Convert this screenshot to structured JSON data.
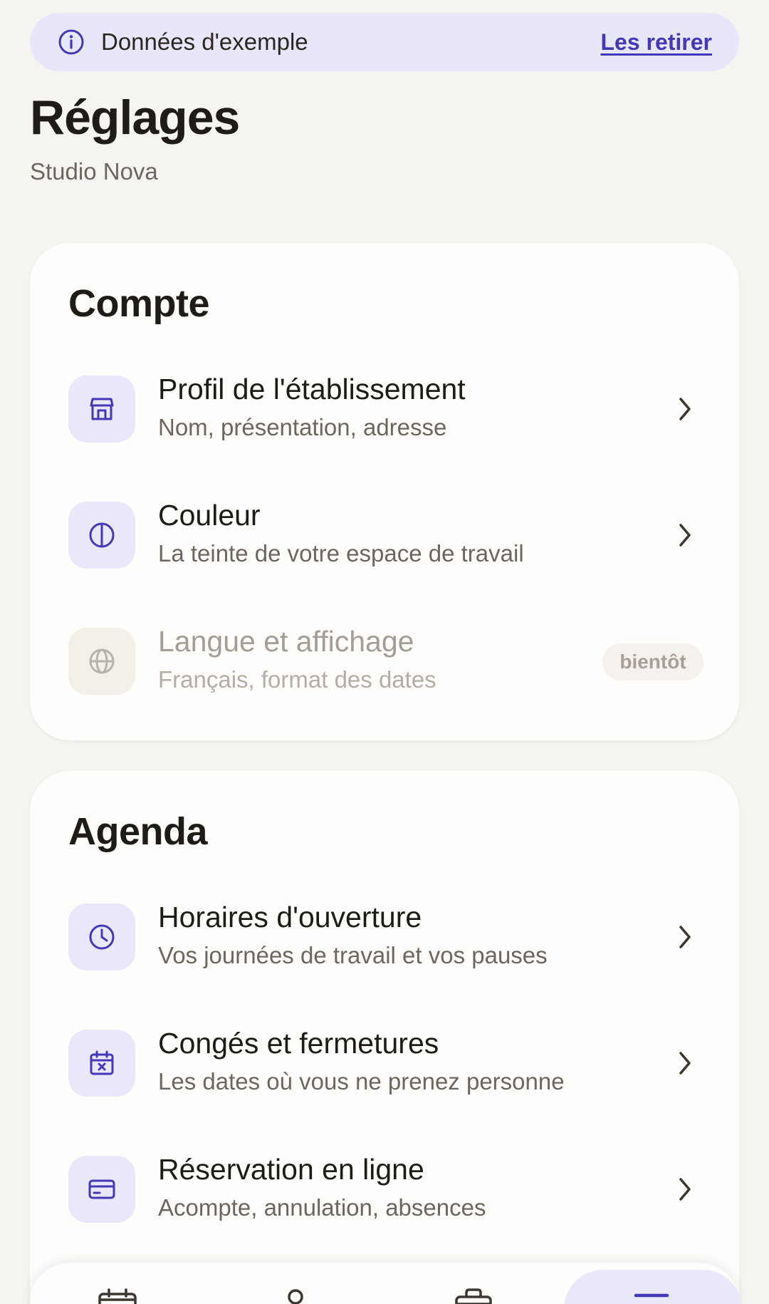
{
  "banner": {
    "text": "Données d'exemple",
    "link": "Les retirer",
    "icon": "info-icon"
  },
  "header": {
    "title": "Réglages",
    "subtitle": "Studio Nova"
  },
  "sections": {
    "compte": {
      "title": "Compte",
      "items": [
        {
          "title": "Profil de l'établissement",
          "subtitle": "Nom, présentation, adresse",
          "icon": "storefront-icon"
        },
        {
          "title": "Couleur",
          "subtitle": "La teinte de votre espace de travail",
          "icon": "contrast-icon"
        },
        {
          "title": "Langue et affichage",
          "subtitle": "Français, format des dates",
          "icon": "globe-icon",
          "badge": "bientôt",
          "disabled": true
        }
      ]
    },
    "agenda": {
      "title": "Agenda",
      "items": [
        {
          "title": "Horaires d'ouverture",
          "subtitle": "Vos journées de travail et vos pauses",
          "icon": "clock-icon"
        },
        {
          "title": "Congés et fermetures",
          "subtitle": "Les dates où vous ne prenez personne",
          "icon": "calendar-x-icon"
        },
        {
          "title": "Réservation en ligne",
          "subtitle": "Acompte, annulation, absences",
          "icon": "credit-card-icon"
        }
      ]
    }
  },
  "bottom_nav": {
    "items": [
      {
        "icon": "calendar-icon"
      },
      {
        "icon": "person-icon"
      },
      {
        "icon": "briefcase-icon"
      },
      {
        "icon": "menu-icon",
        "active": true
      }
    ]
  },
  "colors": {
    "accent": "#4338b8",
    "accent_soft": "#e9e8fb",
    "background": "#f6f4f1",
    "card": "#fefdfb",
    "text": "#1f1b16",
    "muted": "#6d665e"
  }
}
